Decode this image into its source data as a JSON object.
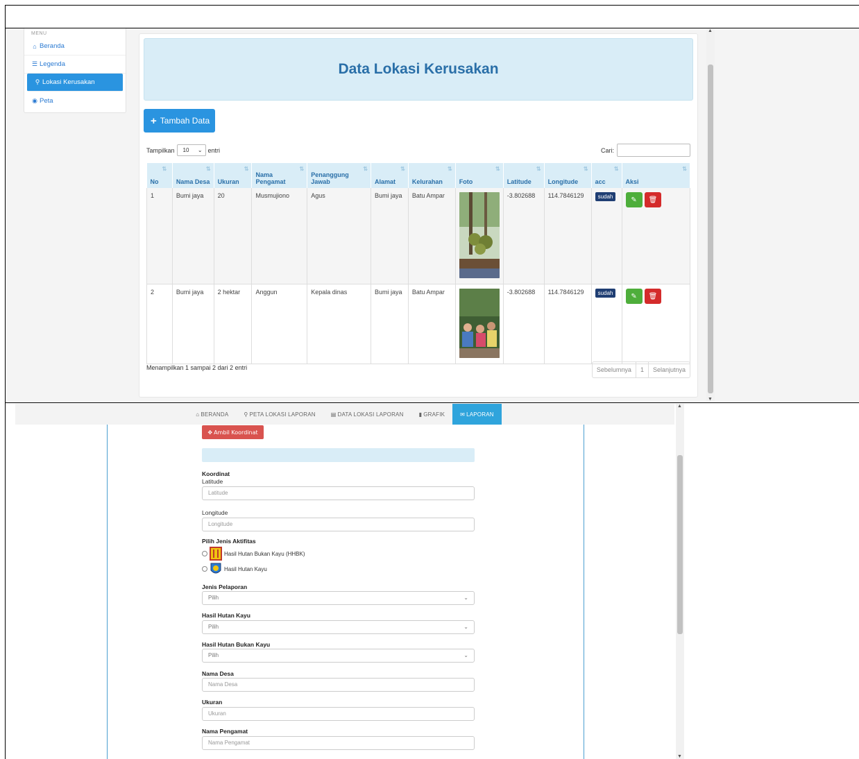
{
  "top": {
    "sidebar": {
      "menu_title": "MENU",
      "items": [
        {
          "label": "Beranda",
          "icon": "home-icon"
        },
        {
          "label": "Legenda",
          "icon": "list-icon"
        },
        {
          "label": "Lokasi Kerusakan",
          "icon": "map-marker-icon",
          "active": true
        },
        {
          "label": "Peta",
          "icon": "globe-icon"
        }
      ]
    },
    "page_title": "Data Lokasi Kerusakan",
    "add_button": "Tambah Data",
    "length": {
      "prefix": "Tampilkan",
      "value": "10",
      "suffix": "entri"
    },
    "search_label": "Cari:",
    "table": {
      "headers": [
        "No",
        "Nama Desa",
        "Ukuran",
        "Nama Pengamat",
        "Penanggung Jawab",
        "Alamat",
        "Kelurahan",
        "Foto",
        "Latitude",
        "Longitude",
        "acc",
        "Aksi"
      ],
      "rows": [
        {
          "no": "1",
          "desa": "Bumi jaya",
          "ukuran": "20",
          "pengamat": "Musmujiono",
          "pj": "Agus",
          "alamat": "Bumi jaya",
          "kelurahan": "Batu Ampar",
          "lat": "-3.802688",
          "lng": "114.7846129",
          "acc": "sudah"
        },
        {
          "no": "2",
          "desa": "Bumi jaya",
          "ukuran": "2 hektar",
          "pengamat": "Anggun",
          "pj": "Kepala dinas",
          "alamat": "Bumi jaya",
          "kelurahan": "Batu Ampar",
          "lat": "-3.802688",
          "lng": "114.7846129",
          "acc": "sudah"
        }
      ]
    },
    "info": "Menampilkan 1 sampai 2 dari 2 entri",
    "pager": {
      "prev": "Sebelumnya",
      "page": "1",
      "next": "Selanjutnya"
    },
    "colors": {
      "primary": "#2a94e0",
      "header_bg": "#d9edf7",
      "badge": "#1f3e73",
      "edit": "#4eae3b",
      "delete": "#d42b2b"
    }
  },
  "bottom": {
    "nav": [
      {
        "label": "BERANDA",
        "icon": "home-icon"
      },
      {
        "label": "PETA LOKASI LAPORAN",
        "icon": "map-marker-icon"
      },
      {
        "label": "DATA LOKASI LAPORAN",
        "icon": "document-icon"
      },
      {
        "label": "GRAFIK",
        "icon": "bar-chart-icon"
      },
      {
        "label": "LAPORAN",
        "icon": "envelope-icon",
        "active": true
      }
    ],
    "ambil_button": "Ambil Koordinat",
    "koordinat_label": "Koordinat",
    "latitude_label": "Latitude",
    "latitude_placeholder": "Latitude",
    "longitude_label": "Longitude",
    "longitude_placeholder": "Longitude",
    "aktifitas_label": "Pilih Jenis Aktifitas",
    "aktifitas_options": [
      "Hasil Hutan Bukan Kayu (HHBK)",
      "Hasil Hutan Kayu"
    ],
    "jenis_label": "Jenis Pelaporan",
    "jenis_value": "Pilih",
    "hhk_label": "Hasil Hutan Kayu",
    "hhk_value": "Pilih",
    "hhbk_label": "Hasil Hutan Bukan Kayu",
    "hhbk_value": "Pilih",
    "desa_label": "Nama Desa",
    "desa_placeholder": "Nama Desa",
    "ukuran_label": "Ukuran",
    "ukuran_placeholder": "Ukuran",
    "pengamat_label": "Nama Pengamat",
    "pengamat_placeholder": "Nama Pengamat"
  }
}
